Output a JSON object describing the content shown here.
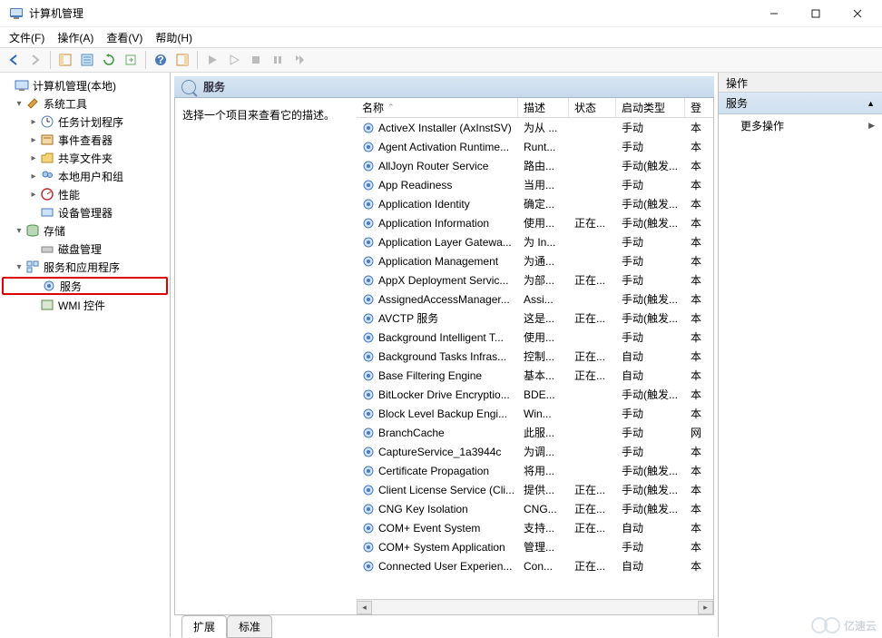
{
  "window": {
    "title": "计算机管理"
  },
  "menu": {
    "file": "文件(F)",
    "action": "操作(A)",
    "view": "查看(V)",
    "help": "帮助(H)"
  },
  "tree": {
    "root": "计算机管理(本地)",
    "sys_tools": "系统工具",
    "task_sched": "任务计划程序",
    "event_viewer": "事件查看器",
    "shared": "共享文件夹",
    "local_users": "本地用户和组",
    "perf": "性能",
    "dev_mgr": "设备管理器",
    "storage": "存储",
    "disk_mgmt": "磁盘管理",
    "svc_apps": "服务和应用程序",
    "services": "服务",
    "wmi": "WMI 控件"
  },
  "services_header": "服务",
  "desc_prompt": "选择一个项目来查看它的描述。",
  "columns": {
    "name": "名称",
    "desc": "描述",
    "state": "状态",
    "start": "启动类型",
    "logon": "登"
  },
  "rows": [
    {
      "name": "ActiveX Installer (AxInstSV)",
      "desc": "为从 ...",
      "state": "",
      "start": "手动",
      "log": "本"
    },
    {
      "name": "Agent Activation Runtime...",
      "desc": "Runt...",
      "state": "",
      "start": "手动",
      "log": "本"
    },
    {
      "name": "AllJoyn Router Service",
      "desc": "路由...",
      "state": "",
      "start": "手动(触发...",
      "log": "本"
    },
    {
      "name": "App Readiness",
      "desc": "当用...",
      "state": "",
      "start": "手动",
      "log": "本"
    },
    {
      "name": "Application Identity",
      "desc": "确定...",
      "state": "",
      "start": "手动(触发...",
      "log": "本"
    },
    {
      "name": "Application Information",
      "desc": "使用...",
      "state": "正在...",
      "start": "手动(触发...",
      "log": "本"
    },
    {
      "name": "Application Layer Gatewa...",
      "desc": "为 In...",
      "state": "",
      "start": "手动",
      "log": "本"
    },
    {
      "name": "Application Management",
      "desc": "为通...",
      "state": "",
      "start": "手动",
      "log": "本"
    },
    {
      "name": "AppX Deployment Servic...",
      "desc": "为部...",
      "state": "正在...",
      "start": "手动",
      "log": "本"
    },
    {
      "name": "AssignedAccessManager...",
      "desc": "Assi...",
      "state": "",
      "start": "手动(触发...",
      "log": "本"
    },
    {
      "name": "AVCTP 服务",
      "desc": "这是...",
      "state": "正在...",
      "start": "手动(触发...",
      "log": "本"
    },
    {
      "name": "Background Intelligent T...",
      "desc": "使用...",
      "state": "",
      "start": "手动",
      "log": "本"
    },
    {
      "name": "Background Tasks Infras...",
      "desc": "控制...",
      "state": "正在...",
      "start": "自动",
      "log": "本"
    },
    {
      "name": "Base Filtering Engine",
      "desc": "基本...",
      "state": "正在...",
      "start": "自动",
      "log": "本"
    },
    {
      "name": "BitLocker Drive Encryptio...",
      "desc": "BDE...",
      "state": "",
      "start": "手动(触发...",
      "log": "本"
    },
    {
      "name": "Block Level Backup Engi...",
      "desc": "Win...",
      "state": "",
      "start": "手动",
      "log": "本"
    },
    {
      "name": "BranchCache",
      "desc": "此服...",
      "state": "",
      "start": "手动",
      "log": "网"
    },
    {
      "name": "CaptureService_1a3944c",
      "desc": "为调...",
      "state": "",
      "start": "手动",
      "log": "本"
    },
    {
      "name": "Certificate Propagation",
      "desc": "将用...",
      "state": "",
      "start": "手动(触发...",
      "log": "本"
    },
    {
      "name": "Client License Service (Cli...",
      "desc": "提供...",
      "state": "正在...",
      "start": "手动(触发...",
      "log": "本"
    },
    {
      "name": "CNG Key Isolation",
      "desc": "CNG...",
      "state": "正在...",
      "start": "手动(触发...",
      "log": "本"
    },
    {
      "name": "COM+ Event System",
      "desc": "支持...",
      "state": "正在...",
      "start": "自动",
      "log": "本"
    },
    {
      "name": "COM+ System Application",
      "desc": "管理...",
      "state": "",
      "start": "手动",
      "log": "本"
    },
    {
      "name": "Connected User Experien...",
      "desc": "Con...",
      "state": "正在...",
      "start": "自动",
      "log": "本"
    }
  ],
  "tabs": {
    "extended": "扩展",
    "standard": "标准"
  },
  "actions": {
    "title": "操作",
    "section": "服务",
    "more": "更多操作"
  },
  "watermark": "亿速云"
}
